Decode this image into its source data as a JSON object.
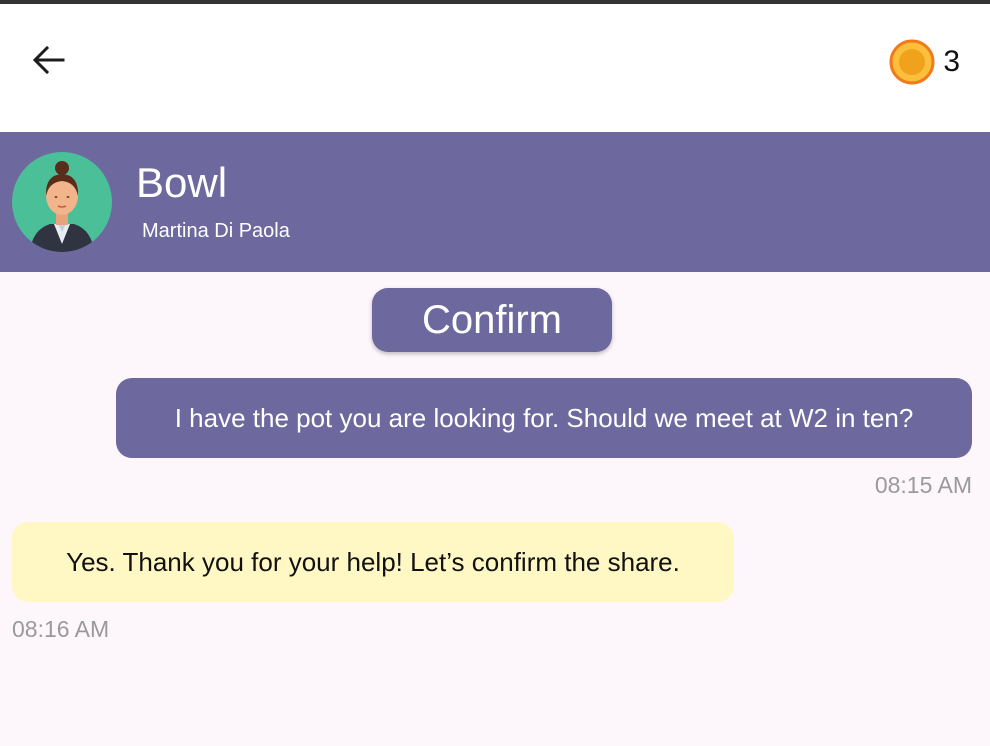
{
  "appbar": {
    "back_icon": "arrow-left-icon",
    "coin_icon": "coin-icon",
    "coin_count": "3"
  },
  "contact": {
    "avatar_icon": "woman-avatar-icon",
    "item_title": "Bowl",
    "owner_name": "Martina Di Paola"
  },
  "actions": {
    "confirm_label": "Confirm"
  },
  "messages": [
    {
      "direction": "outgoing",
      "text": "I have the pot you are looking for. Should we meet at W2 in ten?",
      "time": "08:15 AM"
    },
    {
      "direction": "incoming",
      "text": "Yes. Thank you for your help! Let’s confirm the share.",
      "time": "08:16 AM"
    }
  ],
  "colors": {
    "accent": "#6d689e",
    "incoming_bubble": "#fff8c4",
    "background": "#fdf7fc",
    "coin": "#f5a623"
  }
}
